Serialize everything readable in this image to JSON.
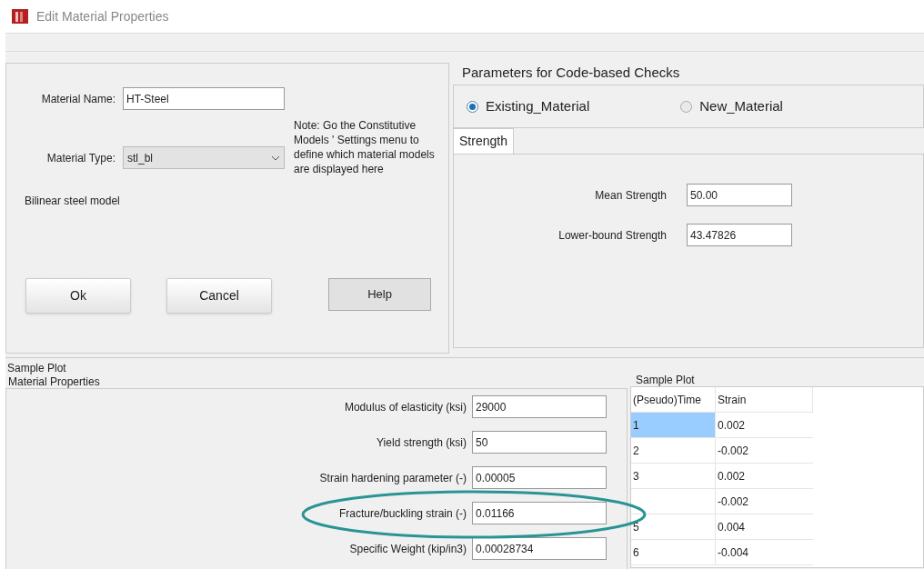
{
  "window": {
    "title": "Edit Material Properties"
  },
  "material": {
    "name_label": "Material Name:",
    "name_value": "HT-Steel",
    "type_label": "Material Type:",
    "type_value": "stl_bl",
    "note_lines": [
      "Note: Go the Constitutive",
      "Models ' Settings menu to",
      "define which material models",
      "are displayed here"
    ],
    "description": "Bilinear steel model"
  },
  "buttons": [
    {
      "label": "Ok",
      "kind": "raised"
    },
    {
      "label": "Cancel",
      "kind": "raised"
    },
    {
      "label": "Help",
      "kind": "flat"
    }
  ],
  "code_checks": {
    "title": "Parameters for Code-based Checks",
    "options": [
      {
        "label": "Existing_Material",
        "selected": true
      },
      {
        "label": "New_Material",
        "selected": false
      }
    ],
    "tabs": [
      {
        "label": "Strength",
        "selected": true
      }
    ],
    "fields": [
      {
        "label": "Mean Strength",
        "value": "50.00"
      },
      {
        "label": "Lower-bound Strength",
        "value": "43.47826"
      }
    ]
  },
  "sample_plot_label": "Sample Plot",
  "material_properties": {
    "title": "Material Properties",
    "fields": [
      {
        "label": "Modulus of elasticity (ksi)",
        "value": "29000"
      },
      {
        "label": "Yield strength (ksi)",
        "value": "50"
      },
      {
        "label": "Strain hardening parameter (-)",
        "value": "0.00005"
      },
      {
        "label": "Fracture/buckling strain (-)",
        "value": "0.01166",
        "highlighted": true
      },
      {
        "label": "Specific Weight (kip/in3)",
        "value": "0.00028734"
      }
    ]
  },
  "sample_plot": {
    "title": "Sample Plot",
    "columns": [
      "(Pseudo)Time",
      "Strain"
    ],
    "rows": [
      {
        "time": "1",
        "strain": "0.002",
        "selected": true
      },
      {
        "time": "2",
        "strain": "-0.002",
        "selected": false
      },
      {
        "time": "3",
        "strain": "0.002",
        "selected": false
      },
      {
        "strain": "-0.002",
        "selected": false
      },
      {
        "time": "5",
        "strain": "0.004",
        "selected": false
      },
      {
        "time": "6",
        "strain": "-0.004",
        "selected": false
      }
    ]
  }
}
